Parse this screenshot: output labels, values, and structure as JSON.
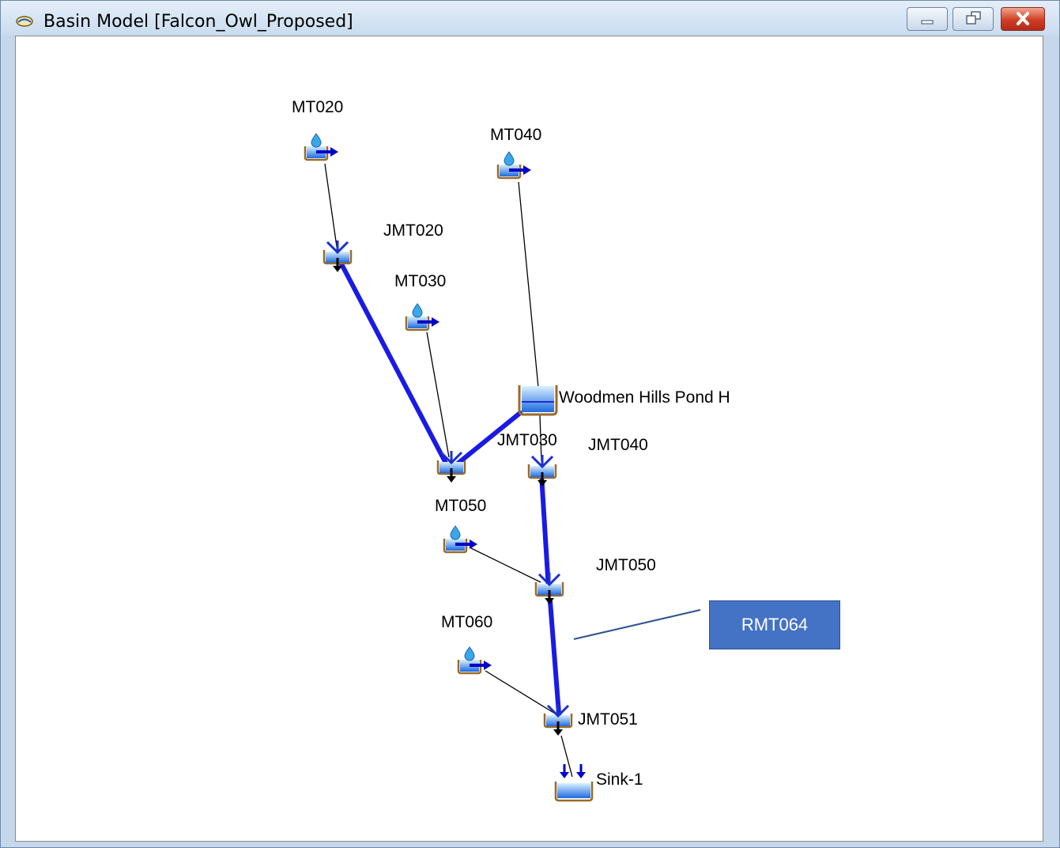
{
  "window": {
    "title": "Basin Model [Falcon_Owl_Proposed]"
  },
  "nodes": {
    "mt020": "MT020",
    "mt040": "MT040",
    "jmt020": "JMT020",
    "mt030": "MT030",
    "pond": "Woodmen Hills Pond H",
    "jmt030": "JMT030",
    "jmt040": "JMT040",
    "mt050": "MT050",
    "jmt050": "JMT050",
    "mt060": "MT060",
    "jmt051": "JMT051",
    "sink": "Sink-1"
  },
  "callout": {
    "label": "RMT064"
  },
  "colors": {
    "reach": "#1a1ae6",
    "connector": "#000000",
    "callout": "#4472c4"
  }
}
